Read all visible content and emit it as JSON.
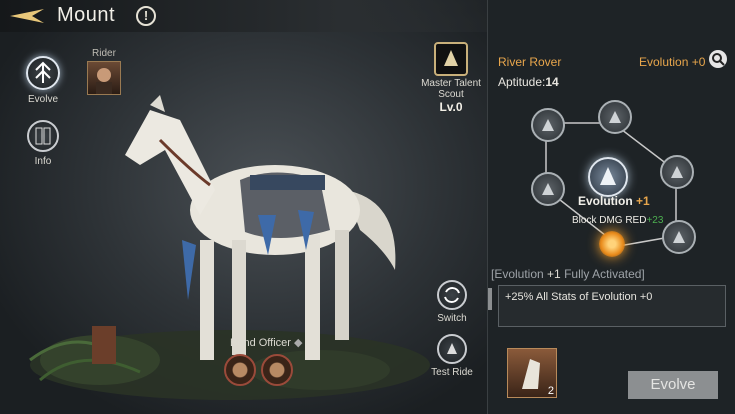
{
  "header": {
    "title": "Mount",
    "alert_symbol": "!"
  },
  "left_menu": {
    "evolve_label": "Evolve",
    "info_label": "Info",
    "rider_label": "Rider"
  },
  "scout": {
    "label_line1": "Master Talent",
    "label_line2": "Scout",
    "level": "Lv.0"
  },
  "bond": {
    "label": "Bond Officer"
  },
  "actions": {
    "switch_label": "Switch",
    "test_ride_label": "Test Ride"
  },
  "panel": {
    "mount_name": "River Rover",
    "evolution_label": "Evolution +0",
    "aptitude_label": "Aptitude:",
    "aptitude_value": "14",
    "center_title": "Evolution",
    "center_value": "+1",
    "block_text": "Block DMG RED",
    "block_value": "+23",
    "fully_activated_prefix": "[Evolution ",
    "fully_activated_value": "+1",
    "fully_activated_suffix": " Fully Activated]",
    "bonus_text": "+25% All Stats of Evolution +0",
    "item_count": "2",
    "evolve_button": "Evolve"
  },
  "colors": {
    "accent_orange": "#e8a64c",
    "accent_green": "#4caf50",
    "panel_bg": "#1e2326"
  }
}
